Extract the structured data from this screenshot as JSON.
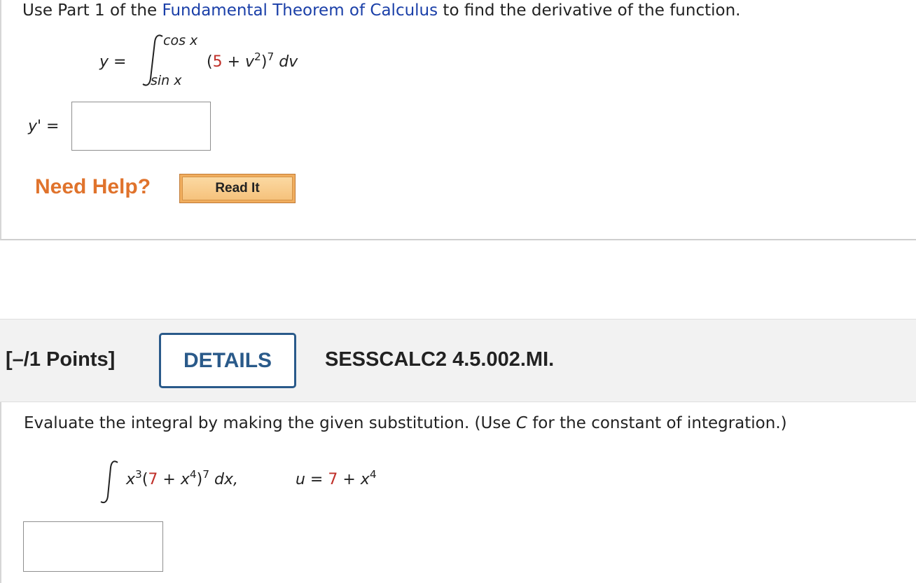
{
  "q1": {
    "prompt_start": "Use Part 1 of the ",
    "prompt_link": "Fundamental Theorem of Calculus",
    "prompt_end": " to find the derivative of the function.",
    "lhs": "y =",
    "upper_limit": "cos x",
    "lower_limit": "sin x",
    "integrand_open": "(",
    "integrand_const": "5",
    "integrand_plus": " + v",
    "integrand_exp": "2",
    "integrand_close": ")",
    "integrand_power": "7",
    "differential": " dv",
    "answer_label": "y' =",
    "answer_value": "",
    "need_help": "Need Help?",
    "read_it": "Read It"
  },
  "q2": {
    "points": "[–/1 Points]",
    "details": "DETAILS",
    "code": "SESSCALC2 4.5.002.MI.",
    "prompt_start": "Evaluate the integral by making the given substitution. (Use ",
    "prompt_var": "C",
    "prompt_end": " for the constant of integration.)",
    "integrand_x": "x",
    "integrand_x_exp": "3",
    "integrand_open": "(",
    "integrand_const": "7",
    "integrand_plus": " + x",
    "integrand_x2_exp": "4",
    "integrand_close": ")",
    "integrand_power": "7",
    "differential": " dx,",
    "sub_lhs": "u = ",
    "sub_const": "7",
    "sub_plus": " + x",
    "sub_exp": "4",
    "answer_value": ""
  },
  "colors": {
    "link": "#1a3fa8",
    "constant": "#c0302a",
    "help": "#e0732c",
    "details_border": "#2a5a8a"
  }
}
